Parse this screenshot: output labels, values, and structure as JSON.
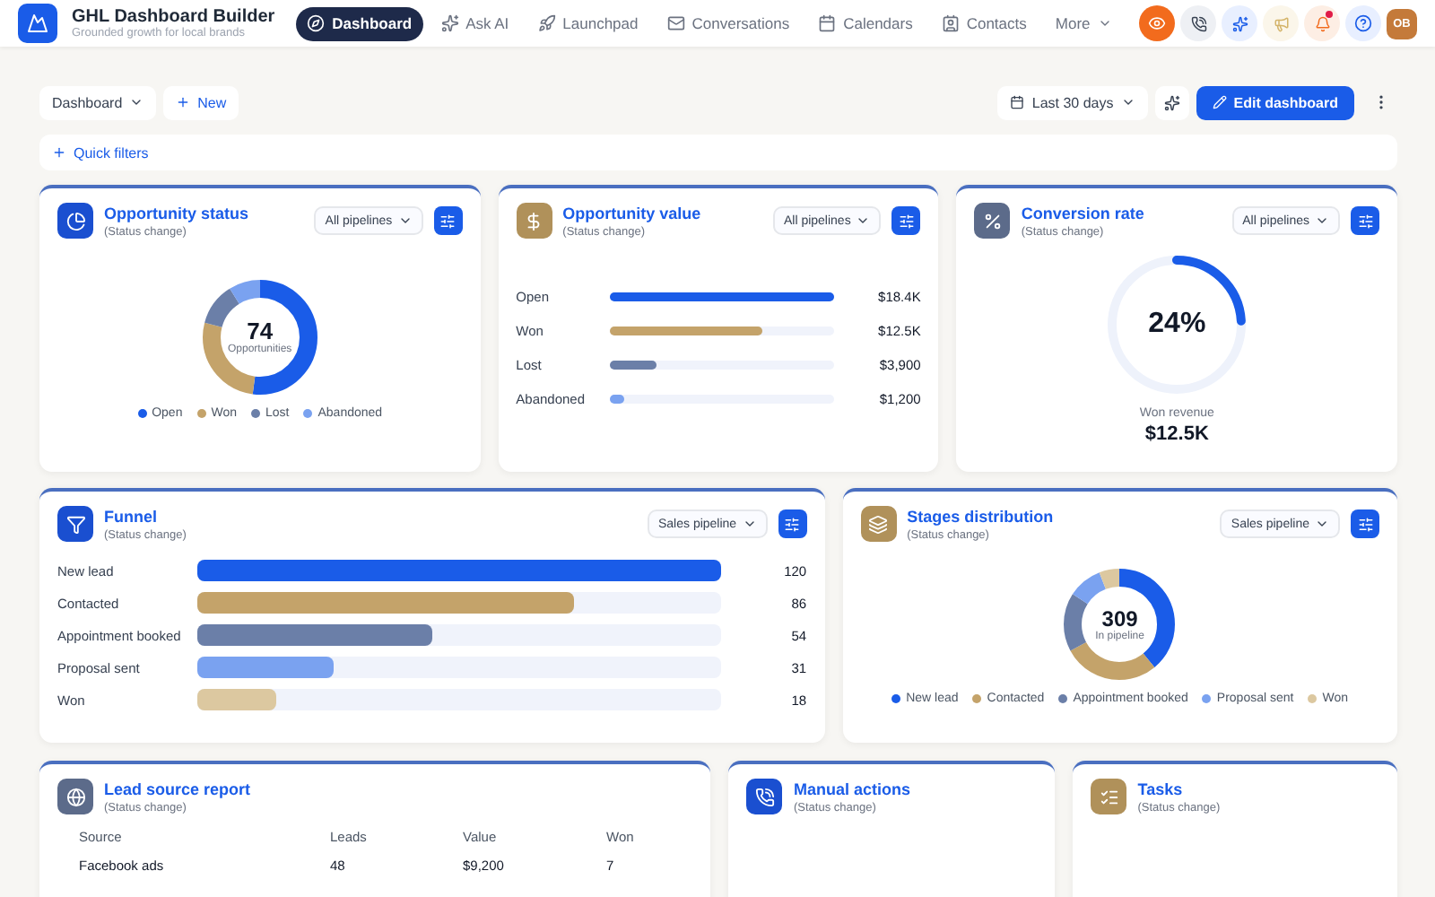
{
  "header": {
    "title": "GHL Dashboard Builder",
    "subtitle": "Grounded growth for local brands",
    "avatar": "OB"
  },
  "nav": [
    {
      "label": "Dashboard",
      "selected": true
    },
    {
      "label": "Ask AI",
      "selected": false
    },
    {
      "label": "Launchpad",
      "selected": false
    },
    {
      "label": "Conversations",
      "selected": false
    },
    {
      "label": "Calendars",
      "selected": false
    },
    {
      "label": "Contacts",
      "selected": false
    },
    {
      "label": "More",
      "selected": false
    }
  ],
  "toolbar": {
    "dashboard_select": "Dashboard",
    "new_button": "New",
    "date_range": "Last 30 days",
    "edit_button": "Edit dashboard"
  },
  "quick_filters": "Quick filters",
  "opportunity_status": {
    "title": "Opportunity status",
    "subtitle": "(Status change)",
    "filter": "All pipelines",
    "center_value": "74",
    "center_label": "Opportunities",
    "legend": [
      {
        "label": "Open",
        "color": "#1a5ce8"
      },
      {
        "label": "Won",
        "color": "#c4a36a"
      },
      {
        "label": "Lost",
        "color": "#6b7fa8"
      },
      {
        "label": "Abandoned",
        "color": "#7aa2f0"
      }
    ]
  },
  "opportunity_value": {
    "title": "Opportunity value",
    "subtitle": "(Status change)",
    "filter": "All pipelines",
    "rows": [
      {
        "label": "Open",
        "value": "$18.4K",
        "level": 1,
        "color": "#1a5ce8"
      },
      {
        "label": "Won",
        "value": "$12.5K",
        "level": 0.68,
        "color": "#c4a36a"
      },
      {
        "label": "Lost",
        "value": "$3,900",
        "level": 0.21,
        "color": "#6b7fa8"
      },
      {
        "label": "Abandoned",
        "value": "$1,200",
        "level": 0.07,
        "color": "#7aa2f0"
      }
    ]
  },
  "conversion_rate": {
    "title": "Conversion rate",
    "subtitle": "(Status change)",
    "filter": "All pipelines",
    "value": "24%",
    "level": 0.24,
    "caption": "Won revenue",
    "amount": "$12.5K"
  },
  "funnel": {
    "title": "Funnel",
    "subtitle": "(Status change)",
    "filter": "Sales pipeline",
    "rows": [
      {
        "label": "New lead",
        "value": "120",
        "level": 1,
        "color": "#1a5ce8"
      },
      {
        "label": "Contacted",
        "value": "86",
        "level": 0.72,
        "color": "#c4a36a"
      },
      {
        "label": "Appointment booked",
        "value": "54",
        "level": 0.45,
        "color": "#6b7fa8"
      },
      {
        "label": "Proposal sent",
        "value": "31",
        "level": 0.26,
        "color": "#7aa2f0"
      },
      {
        "label": "Won",
        "value": "18",
        "level": 0.15,
        "color": "#dcc8a0"
      }
    ]
  },
  "stages_distribution": {
    "title": "Stages distribution",
    "subtitle": "(Status change)",
    "filter": "Sales pipeline",
    "center_value": "309",
    "center_label": "In pipeline",
    "legend": [
      {
        "label": "New lead",
        "color": "#1a5ce8"
      },
      {
        "label": "Contacted",
        "color": "#c4a36a"
      },
      {
        "label": "Appointment booked",
        "color": "#6b7fa8"
      },
      {
        "label": "Proposal sent",
        "color": "#7aa2f0"
      },
      {
        "label": "Won",
        "color": "#dcc8a0"
      }
    ]
  },
  "lead_source_report": {
    "title": "Lead source report",
    "subtitle": "(Status change)",
    "columns": [
      "Source",
      "Leads",
      "Value",
      "Won"
    ],
    "rows": [
      [
        "Facebook ads",
        "48",
        "$9,200",
        "7"
      ]
    ]
  },
  "manual_actions": {
    "title": "Manual actions",
    "subtitle": "(Status change)"
  },
  "tasks": {
    "title": "Tasks",
    "subtitle": "(Status change)"
  }
}
